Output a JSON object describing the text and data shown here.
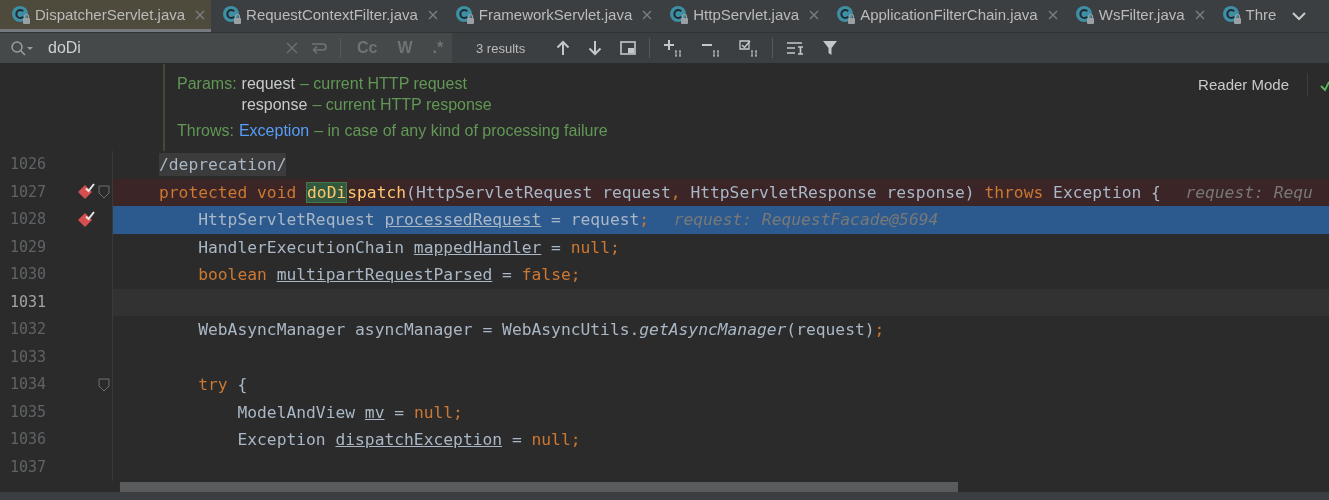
{
  "tabs": [
    {
      "label": "DispatcherServlet.java",
      "selected": true,
      "closable": true
    },
    {
      "label": "RequestContextFilter.java",
      "selected": false,
      "closable": true
    },
    {
      "label": "FrameworkServlet.java",
      "selected": false,
      "closable": true
    },
    {
      "label": "HttpServlet.java",
      "selected": false,
      "closable": true
    },
    {
      "label": "ApplicationFilterChain.java",
      "selected": false,
      "closable": true
    },
    {
      "label": "WsFilter.java",
      "selected": false,
      "closable": true
    },
    {
      "label": "Thre",
      "selected": false,
      "closable": false
    }
  ],
  "search": {
    "value": "doDi",
    "options": [
      {
        "label": "Cc",
        "selected": false
      },
      {
        "label": "W",
        "selected": false
      },
      {
        "label": ".*",
        "selected": false
      }
    ],
    "results": "3 results"
  },
  "doc": {
    "params_label": "Params:",
    "params": [
      {
        "name": "request",
        "description": "– current HTTP request"
      },
      {
        "name": "response",
        "description": "– current HTTP response"
      }
    ],
    "throws_label": "Throws:",
    "throws": {
      "name": "Exception",
      "description": "– in case of any kind of processing failure"
    }
  },
  "reader_mode": "Reader Mode",
  "lines": [
    {
      "number": "1026",
      "kind": "plain",
      "breakpoint": false,
      "fold": false,
      "tokens": [
        {
          "text": "/deprecation/",
          "kind": "annotation"
        }
      ]
    },
    {
      "number": "1027",
      "kind": "breakpoint",
      "breakpoint": true,
      "fold": true,
      "tokens": [
        {
          "text": "protected void ",
          "kind": "keyword"
        },
        {
          "text": "doDi",
          "kind": "match"
        },
        {
          "text": "spatch",
          "kind": "declaration"
        },
        {
          "text": "(HttpServletRequest request",
          "kind": "plain"
        },
        {
          "text": ", ",
          "kind": "keyword"
        },
        {
          "text": "HttpServletResponse response) ",
          "kind": "plain"
        },
        {
          "text": "throws ",
          "kind": "keyword"
        },
        {
          "text": "Exception {",
          "kind": "plain"
        }
      ],
      "hint": "request: Requ"
    },
    {
      "number": "1028",
      "kind": "current",
      "breakpoint": true,
      "fold": false,
      "tokens": [
        {
          "text": "    HttpServletRequest ",
          "kind": "plain"
        },
        {
          "text": "processedRequest",
          "kind": "variable"
        },
        {
          "text": " = request",
          "kind": "plain"
        },
        {
          "text": ";",
          "kind": "keyword"
        }
      ],
      "hint": "request: RequestFacade@5694"
    },
    {
      "number": "1029",
      "kind": "plain",
      "breakpoint": false,
      "fold": false,
      "tokens": [
        {
          "text": "    HandlerExecutionChain ",
          "kind": "plain"
        },
        {
          "text": "mappedHandler",
          "kind": "variable"
        },
        {
          "text": " = ",
          "kind": "plain"
        },
        {
          "text": "null;",
          "kind": "keyword"
        }
      ]
    },
    {
      "number": "1030",
      "kind": "plain",
      "breakpoint": false,
      "fold": false,
      "tokens": [
        {
          "text": "    boolean ",
          "kind": "keyword"
        },
        {
          "text": "multipartRequestParsed",
          "kind": "variable"
        },
        {
          "text": " = ",
          "kind": "plain"
        },
        {
          "text": "false;",
          "kind": "keyword"
        }
      ]
    },
    {
      "number": "1031",
      "kind": "caret",
      "breakpoint": false,
      "fold": false
    },
    {
      "number": "1032",
      "kind": "plain",
      "breakpoint": false,
      "fold": false,
      "tokens": [
        {
          "text": "    WebAsyncManager asyncManager = WebAsyncUtils.",
          "kind": "plain"
        },
        {
          "text": "getAsyncManager",
          "kind": "static-call"
        },
        {
          "text": "(request)",
          "kind": "plain"
        },
        {
          "text": ";",
          "kind": "keyword"
        }
      ]
    },
    {
      "number": "1033",
      "kind": "plain",
      "breakpoint": false,
      "fold": false
    },
    {
      "number": "1034",
      "kind": "plain",
      "breakpoint": false,
      "fold": true,
      "tokens": [
        {
          "text": "    try ",
          "kind": "keyword"
        },
        {
          "text": "{",
          "kind": "plain"
        }
      ]
    },
    {
      "number": "1035",
      "kind": "plain",
      "breakpoint": false,
      "fold": false,
      "tokens": [
        {
          "text": "        ModelAndView ",
          "kind": "plain"
        },
        {
          "text": "mv",
          "kind": "variable"
        },
        {
          "text": " = ",
          "kind": "plain"
        },
        {
          "text": "null;",
          "kind": "keyword"
        }
      ]
    },
    {
      "number": "1036",
      "kind": "plain",
      "breakpoint": false,
      "fold": false,
      "tokens": [
        {
          "text": "        Exception ",
          "kind": "plain"
        },
        {
          "text": "dispatchException",
          "kind": "variable"
        },
        {
          "text": " = ",
          "kind": "plain"
        },
        {
          "text": "null;",
          "kind": "keyword"
        }
      ]
    },
    {
      "number": "1037",
      "kind": "plain",
      "breakpoint": false,
      "fold": false
    }
  ]
}
